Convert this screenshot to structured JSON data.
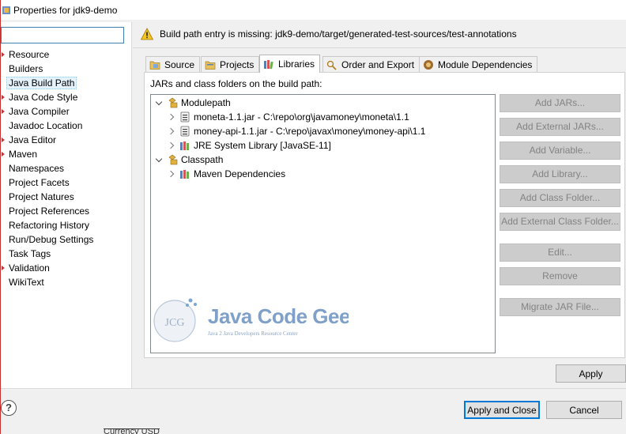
{
  "window": {
    "title": "Properties for jdk9-demo"
  },
  "left_panel": {
    "filter": {
      "value": "",
      "placeholder": ""
    },
    "items": [
      {
        "label": "Resource",
        "expandable": true
      },
      {
        "label": "Builders",
        "expandable": false
      },
      {
        "label": "Java Build Path",
        "expandable": false,
        "selected": true
      },
      {
        "label": "Java Code Style",
        "expandable": true
      },
      {
        "label": "Java Compiler",
        "expandable": true
      },
      {
        "label": "Javadoc Location",
        "expandable": false
      },
      {
        "label": "Java Editor",
        "expandable": true
      },
      {
        "label": "Maven",
        "expandable": true
      },
      {
        "label": "Namespaces",
        "expandable": false
      },
      {
        "label": "Project Facets",
        "expandable": false
      },
      {
        "label": "Project Natures",
        "expandable": false
      },
      {
        "label": "Project References",
        "expandable": false
      },
      {
        "label": "Refactoring History",
        "expandable": false
      },
      {
        "label": "Run/Debug Settings",
        "expandable": false
      },
      {
        "label": "Task Tags",
        "expandable": false
      },
      {
        "label": "Validation",
        "expandable": true
      },
      {
        "label": "WikiText",
        "expandable": false
      }
    ],
    "help_label": "?"
  },
  "warning": {
    "text": "Build path entry is missing: jdk9-demo/target/generated-test-sources/test-annotations"
  },
  "tabs": [
    {
      "label": "Source",
      "icon": "source-folder-icon"
    },
    {
      "label": "Projects",
      "icon": "projects-icon"
    },
    {
      "label": "Libraries",
      "icon": "libraries-icon",
      "active": true
    },
    {
      "label": "Order and Export",
      "icon": "order-export-icon"
    },
    {
      "label": "Module Dependencies",
      "icon": "module-dependencies-icon"
    }
  ],
  "libraries": {
    "section_label": "JARs and class folders on the build path:",
    "tree": {
      "modulepath": {
        "label": "Modulepath",
        "children": [
          "moneta-1.1.jar - C:\\repo\\org\\javamoney\\moneta\\1.1",
          "money-api-1.1.jar - C:\\repo\\javax\\money\\money-api\\1.1",
          "JRE System Library [JavaSE-11]"
        ]
      },
      "classpath": {
        "label": "Classpath",
        "children": [
          "Maven Dependencies"
        ]
      }
    },
    "watermark": {
      "logo_text": "JCG",
      "brand": "Java Code Geeks",
      "tagline": "Java 2 Java Developers Resource Center"
    },
    "buttons": {
      "add_jars": "Add JARs...",
      "add_external_jars": "Add External JARs...",
      "add_variable": "Add Variable...",
      "add_library": "Add Library...",
      "add_class_folder": "Add Class Folder...",
      "add_external_class_folder": "Add External Class Folder...",
      "edit": "Edit...",
      "remove": "Remove",
      "migrate_jar": "Migrate JAR File..."
    }
  },
  "footer": {
    "apply": "Apply",
    "apply_and_close": "Apply and Close",
    "cancel": "Cancel",
    "peek_text": "Currency USD"
  }
}
